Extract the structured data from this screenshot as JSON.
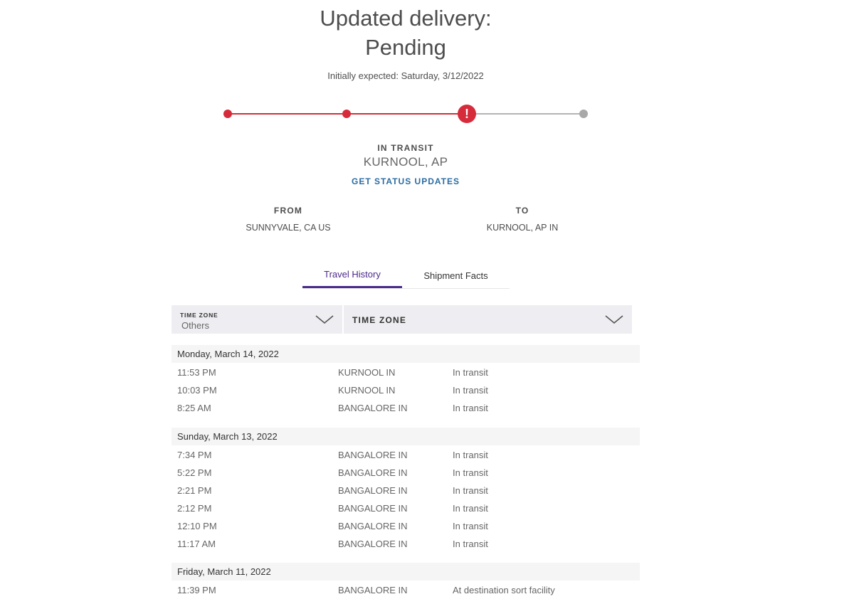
{
  "header": {
    "title_line1": "Updated delivery:",
    "title_line2": "Pending",
    "initially_expected": "Initially expected: Saturday, 3/12/2022"
  },
  "progress": {
    "steps_total": 4,
    "current_step": 3,
    "alert_symbol": "!",
    "active_color": "#d62b3a",
    "inactive_color": "#b3b3b3"
  },
  "status": {
    "label": "IN TRANSIT",
    "location": "KURNOOL, AP",
    "updates_link": "GET STATUS UPDATES"
  },
  "route": {
    "from_label": "FROM",
    "from_value": "SUNNYVALE, CA US",
    "to_label": "TO",
    "to_value": "KURNOOL, AP IN"
  },
  "tabs": [
    {
      "label": "Travel History",
      "active": true
    },
    {
      "label": "Shipment Facts",
      "active": false
    }
  ],
  "timezone": {
    "small_label": "TIME ZONE",
    "selected": "Others",
    "second_label": "TIME ZONE"
  },
  "history": [
    {
      "date": "Monday, March 14, 2022",
      "events": [
        {
          "time": "11:53 PM",
          "location": "KURNOOL IN",
          "status": "In transit"
        },
        {
          "time": "10:03 PM",
          "location": "KURNOOL IN",
          "status": "In transit"
        },
        {
          "time": "8:25 AM",
          "location": "BANGALORE IN",
          "status": "In transit"
        }
      ]
    },
    {
      "date": "Sunday, March 13, 2022",
      "events": [
        {
          "time": "7:34 PM",
          "location": "BANGALORE IN",
          "status": "In transit"
        },
        {
          "time": "5:22 PM",
          "location": "BANGALORE IN",
          "status": "In transit"
        },
        {
          "time": "2:21 PM",
          "location": "BANGALORE IN",
          "status": "In transit"
        },
        {
          "time": "2:12 PM",
          "location": "BANGALORE IN",
          "status": "In transit"
        },
        {
          "time": "12:10 PM",
          "location": "BANGALORE IN",
          "status": "In transit"
        },
        {
          "time": "11:17 AM",
          "location": "BANGALORE IN",
          "status": "In transit"
        }
      ]
    },
    {
      "date": "Friday, March 11, 2022",
      "events": [
        {
          "time": "11:39 PM",
          "location": "BANGALORE IN",
          "status": "At destination sort facility"
        }
      ]
    }
  ]
}
